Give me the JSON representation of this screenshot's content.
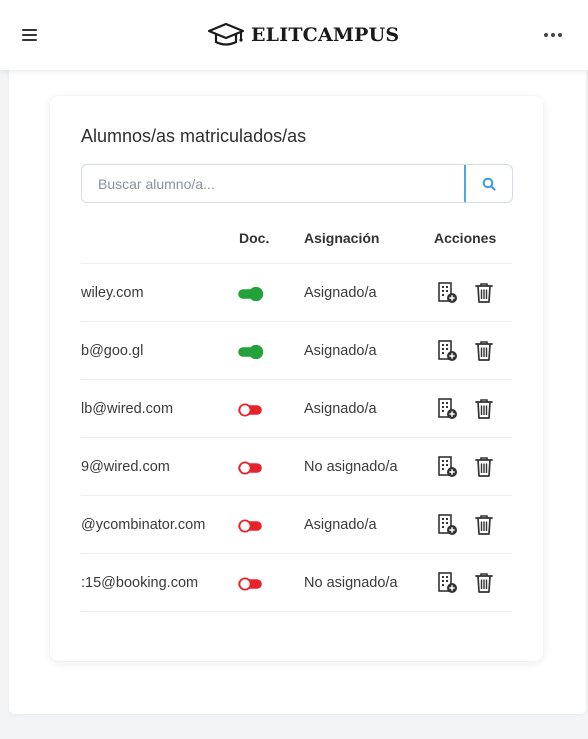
{
  "header": {
    "brand": "ELITCAMPUS",
    "menu_icon": "hamburger-menu-icon",
    "brand_icon": "graduation-cap-icon",
    "more_icon": "more-horizontal-icon"
  },
  "card": {
    "title": "Alumnos/as matriculados/as",
    "search": {
      "placeholder": "Buscar alumno/a...",
      "value": "",
      "button_icon": "search-icon"
    }
  },
  "table": {
    "columns": {
      "email": "",
      "doc": "Doc.",
      "assignment": "Asignación",
      "actions": "Acciones"
    },
    "rows": [
      {
        "email": "wiley.com",
        "doc_on": true,
        "assignment": "Asignado/a"
      },
      {
        "email": "b@goo.gl",
        "doc_on": true,
        "assignment": "Asignado/a"
      },
      {
        "email": "lb@wired.com",
        "doc_on": false,
        "assignment": "Asignado/a"
      },
      {
        "email": "9@wired.com",
        "doc_on": false,
        "assignment": "No asignado/a"
      },
      {
        "email": "@ycombinator.com",
        "doc_on": false,
        "assignment": "Asignado/a"
      },
      {
        "email": ":15@booking.com",
        "doc_on": false,
        "assignment": "No asignado/a"
      }
    ],
    "action_icons": [
      "building-add-icon",
      "trash-icon"
    ]
  },
  "colors": {
    "toggle_on": "#22a33a",
    "toggle_off": "#e8222a",
    "accent": "#4aa8e3"
  }
}
